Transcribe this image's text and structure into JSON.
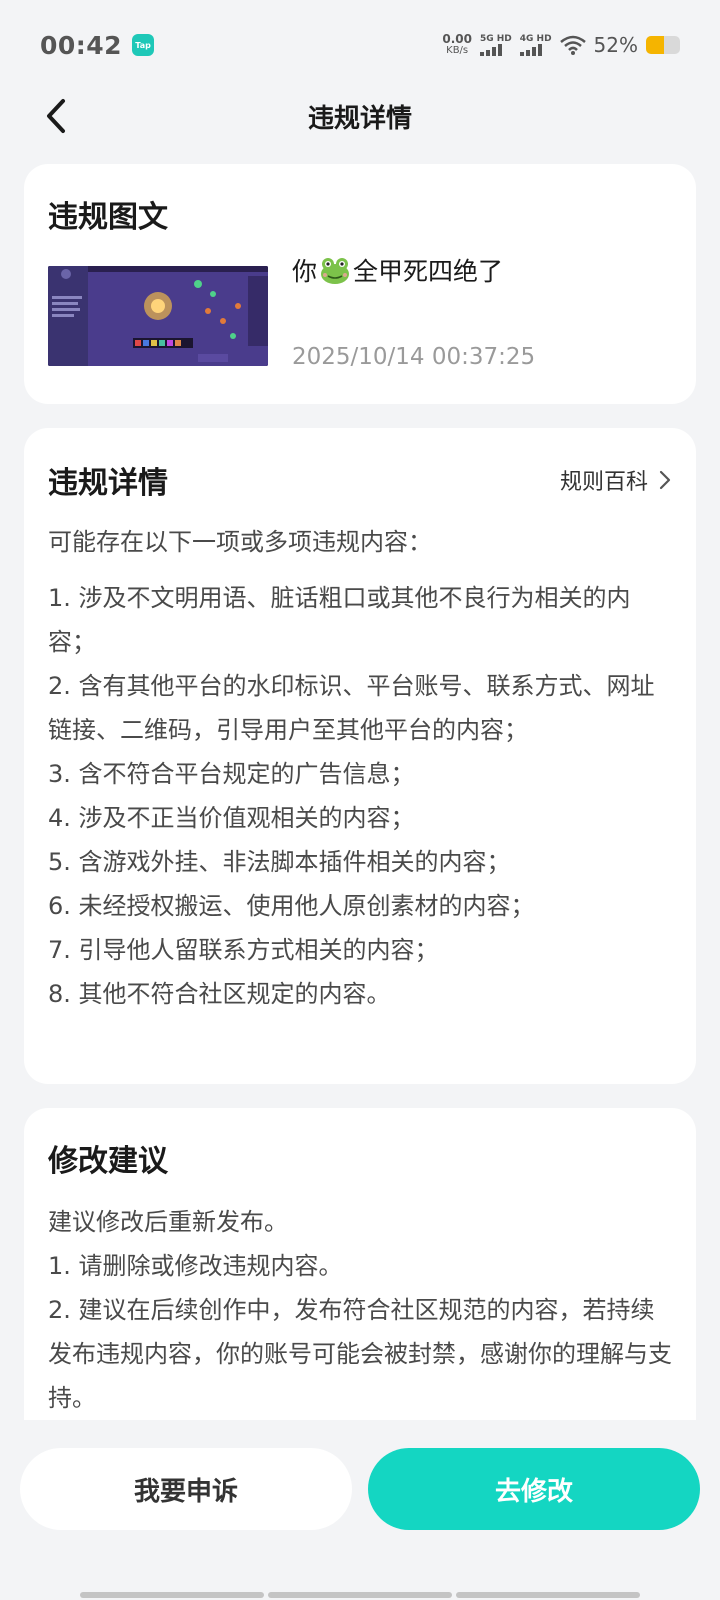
{
  "status_bar": {
    "time": "00:42",
    "app_badge": "Tap",
    "net_speed_value": "0.00",
    "net_speed_unit": "KB/s",
    "signal1_label": "5G HD",
    "signal2_label": "4G HD",
    "battery_percent": "52%",
    "battery_level": 0.52,
    "battery_color": "#f5b400"
  },
  "header": {
    "title": "违规详情"
  },
  "post_card": {
    "title": "违规图文",
    "post_text_before": "你",
    "post_text_after": "全甲死四绝了",
    "emoji_icon": "frog-icon",
    "post_time": "2025/10/14 00:37:25"
  },
  "details_card": {
    "title": "违规详情",
    "rules_link": "规则百科",
    "intro": "可能存在以下一项或多项违规内容：",
    "items": [
      "1. 涉及不文明用语、脏话粗口或其他不良行为相关的内容；",
      "2. 含有其他平台的水印标识、平台账号、联系方式、网址链接、二维码，引导用户至其他平台的内容；",
      "3. 含不符合平台规定的广告信息；",
      "4. 涉及不正当价值观相关的内容；",
      "5. 含游戏外挂、非法脚本插件相关的内容；",
      "6. 未经授权搬运、使用他人原创素材的内容；",
      "7. 引导他人留联系方式相关的内容；",
      "8. 其他不符合社区规定的内容。"
    ]
  },
  "suggestion_card": {
    "title": "修改建议",
    "lines": [
      "建议修改后重新发布。",
      "1. 请删除或修改违规内容。",
      "2. 建议在后续创作中，发布符合社区规范的内容，若持续发布违规内容，你的账号可能会被封禁，感谢你的理解与支持。"
    ]
  },
  "actions": {
    "appeal_label": "我要申诉",
    "edit_label": "去修改",
    "accent_color": "#14d6c2"
  }
}
